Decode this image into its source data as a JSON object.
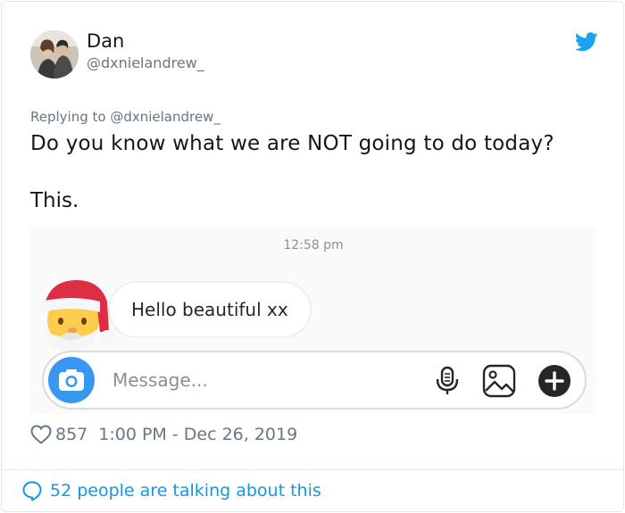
{
  "author": {
    "display_name": "Dan",
    "handle": "@dxnielandrew_"
  },
  "tweet": {
    "replying_to": "Replying to @dxnielandrew_",
    "line1": "Do you know what we are NOT going to do today?",
    "line2": "This."
  },
  "screenshot": {
    "timestamp": "12:58 pm",
    "message": "Hello beautiful xx",
    "input_placeholder": "Message..."
  },
  "stats": {
    "likes": "857",
    "posted": "1:00 PM - Dec 26, 2019"
  },
  "footer": {
    "conversation": "52 people are talking about this"
  },
  "colors": {
    "twitter_blue": "#1da1f2",
    "link_blue": "#1b95e0",
    "instagram_blue": "#3897f0",
    "muted_text": "#657786"
  },
  "icons": [
    "twitter-bird-icon",
    "santa-emoji-icon",
    "camera-icon",
    "microphone-icon",
    "gallery-icon",
    "plus-icon",
    "heart-icon",
    "comment-bubble-icon"
  ]
}
